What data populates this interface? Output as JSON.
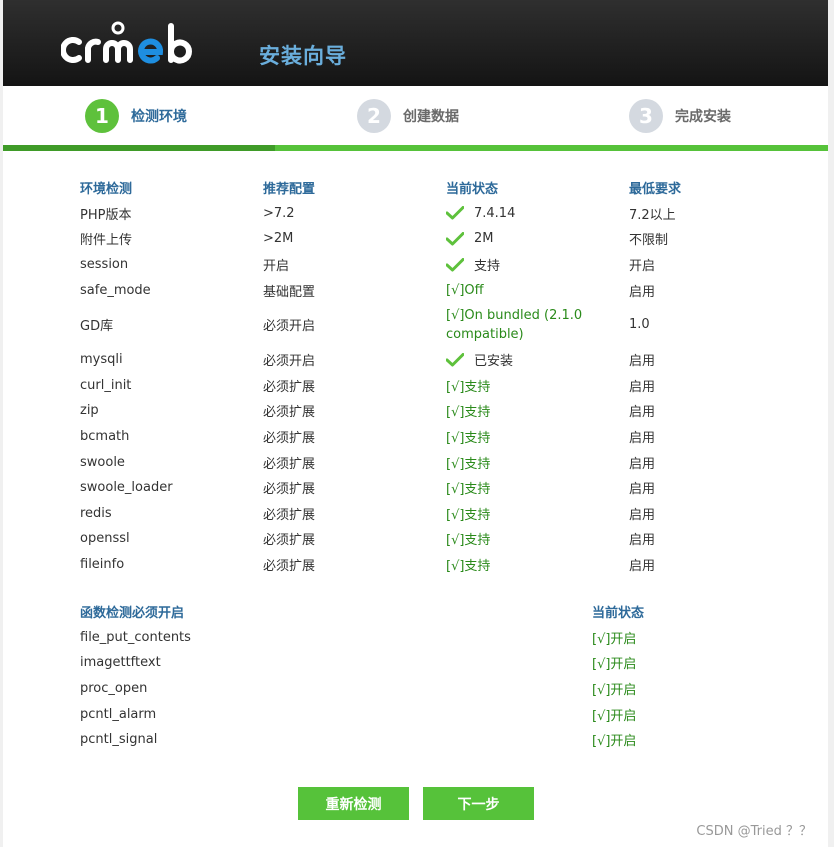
{
  "header": {
    "logo_text": "crmeb",
    "title": "安装向导"
  },
  "steps": [
    {
      "num": "1",
      "label": "检测环境",
      "state": "active"
    },
    {
      "num": "2",
      "label": "创建数据",
      "state": "inactive"
    },
    {
      "num": "3",
      "label": "完成安装",
      "state": "inactive"
    }
  ],
  "env_table": {
    "headers": [
      "环境检测",
      "推荐配置",
      "当前状态",
      "最低要求"
    ],
    "rows": [
      {
        "name": "PHP版本",
        "recommend": ">7.2",
        "status": "7.4.14",
        "status_icon": "check",
        "min": "7.2以上"
      },
      {
        "name": "附件上传",
        "recommend": ">2M",
        "status": "2M",
        "status_icon": "check",
        "min": "不限制"
      },
      {
        "name": "session",
        "recommend": "开启",
        "status": "支持",
        "status_icon": "check",
        "min": "开启"
      },
      {
        "name": "safe_mode",
        "recommend": "基础配置",
        "status": "[√]Off",
        "status_icon": "text",
        "min": "启用"
      },
      {
        "name": "GD库",
        "recommend": "必须开启",
        "status": "[√]On bundled (2.1.0 compatible)",
        "status_icon": "text",
        "min": "1.0"
      },
      {
        "name": "mysqli",
        "recommend": "必须开启",
        "status": "已安装",
        "status_icon": "check",
        "min": "启用"
      },
      {
        "name": "curl_init",
        "recommend": "必须扩展",
        "status": "[√]支持",
        "status_icon": "text",
        "min": "启用"
      },
      {
        "name": "zip",
        "recommend": "必须扩展",
        "status": "[√]支持",
        "status_icon": "text",
        "min": "启用"
      },
      {
        "name": "bcmath",
        "recommend": "必须扩展",
        "status": "[√]支持",
        "status_icon": "text",
        "min": "启用"
      },
      {
        "name": "swoole",
        "recommend": "必须扩展",
        "status": "[√]支持",
        "status_icon": "text",
        "min": "启用"
      },
      {
        "name": "swoole_loader",
        "recommend": "必须扩展",
        "status": "[√]支持",
        "status_icon": "text",
        "min": "启用"
      },
      {
        "name": "redis",
        "recommend": "必须扩展",
        "status": "[√]支持",
        "status_icon": "text",
        "min": "启用"
      },
      {
        "name": "openssl",
        "recommend": "必须扩展",
        "status": "[√]支持",
        "status_icon": "text",
        "min": "启用"
      },
      {
        "name": "fileinfo",
        "recommend": "必须扩展",
        "status": "[√]支持",
        "status_icon": "text",
        "min": "启用"
      }
    ]
  },
  "fn_table": {
    "headers": [
      "函数检测必须开启",
      "当前状态"
    ],
    "rows": [
      {
        "name": "file_put_contents",
        "status": "[√]开启"
      },
      {
        "name": "imagettftext",
        "status": "[√]开启"
      },
      {
        "name": "proc_open",
        "status": "[√]开启"
      },
      {
        "name": "pcntl_alarm",
        "status": "[√]开启"
      },
      {
        "name": "pcntl_signal",
        "status": "[√]开启"
      }
    ]
  },
  "buttons": {
    "recheck": "重新检测",
    "next": "下一步"
  },
  "watermark": "CSDN @Tried ？？",
  "colors": {
    "accent_green": "#56c23a",
    "header_blue": "#2e6a9a",
    "ok_green": "#2a8a1a"
  }
}
